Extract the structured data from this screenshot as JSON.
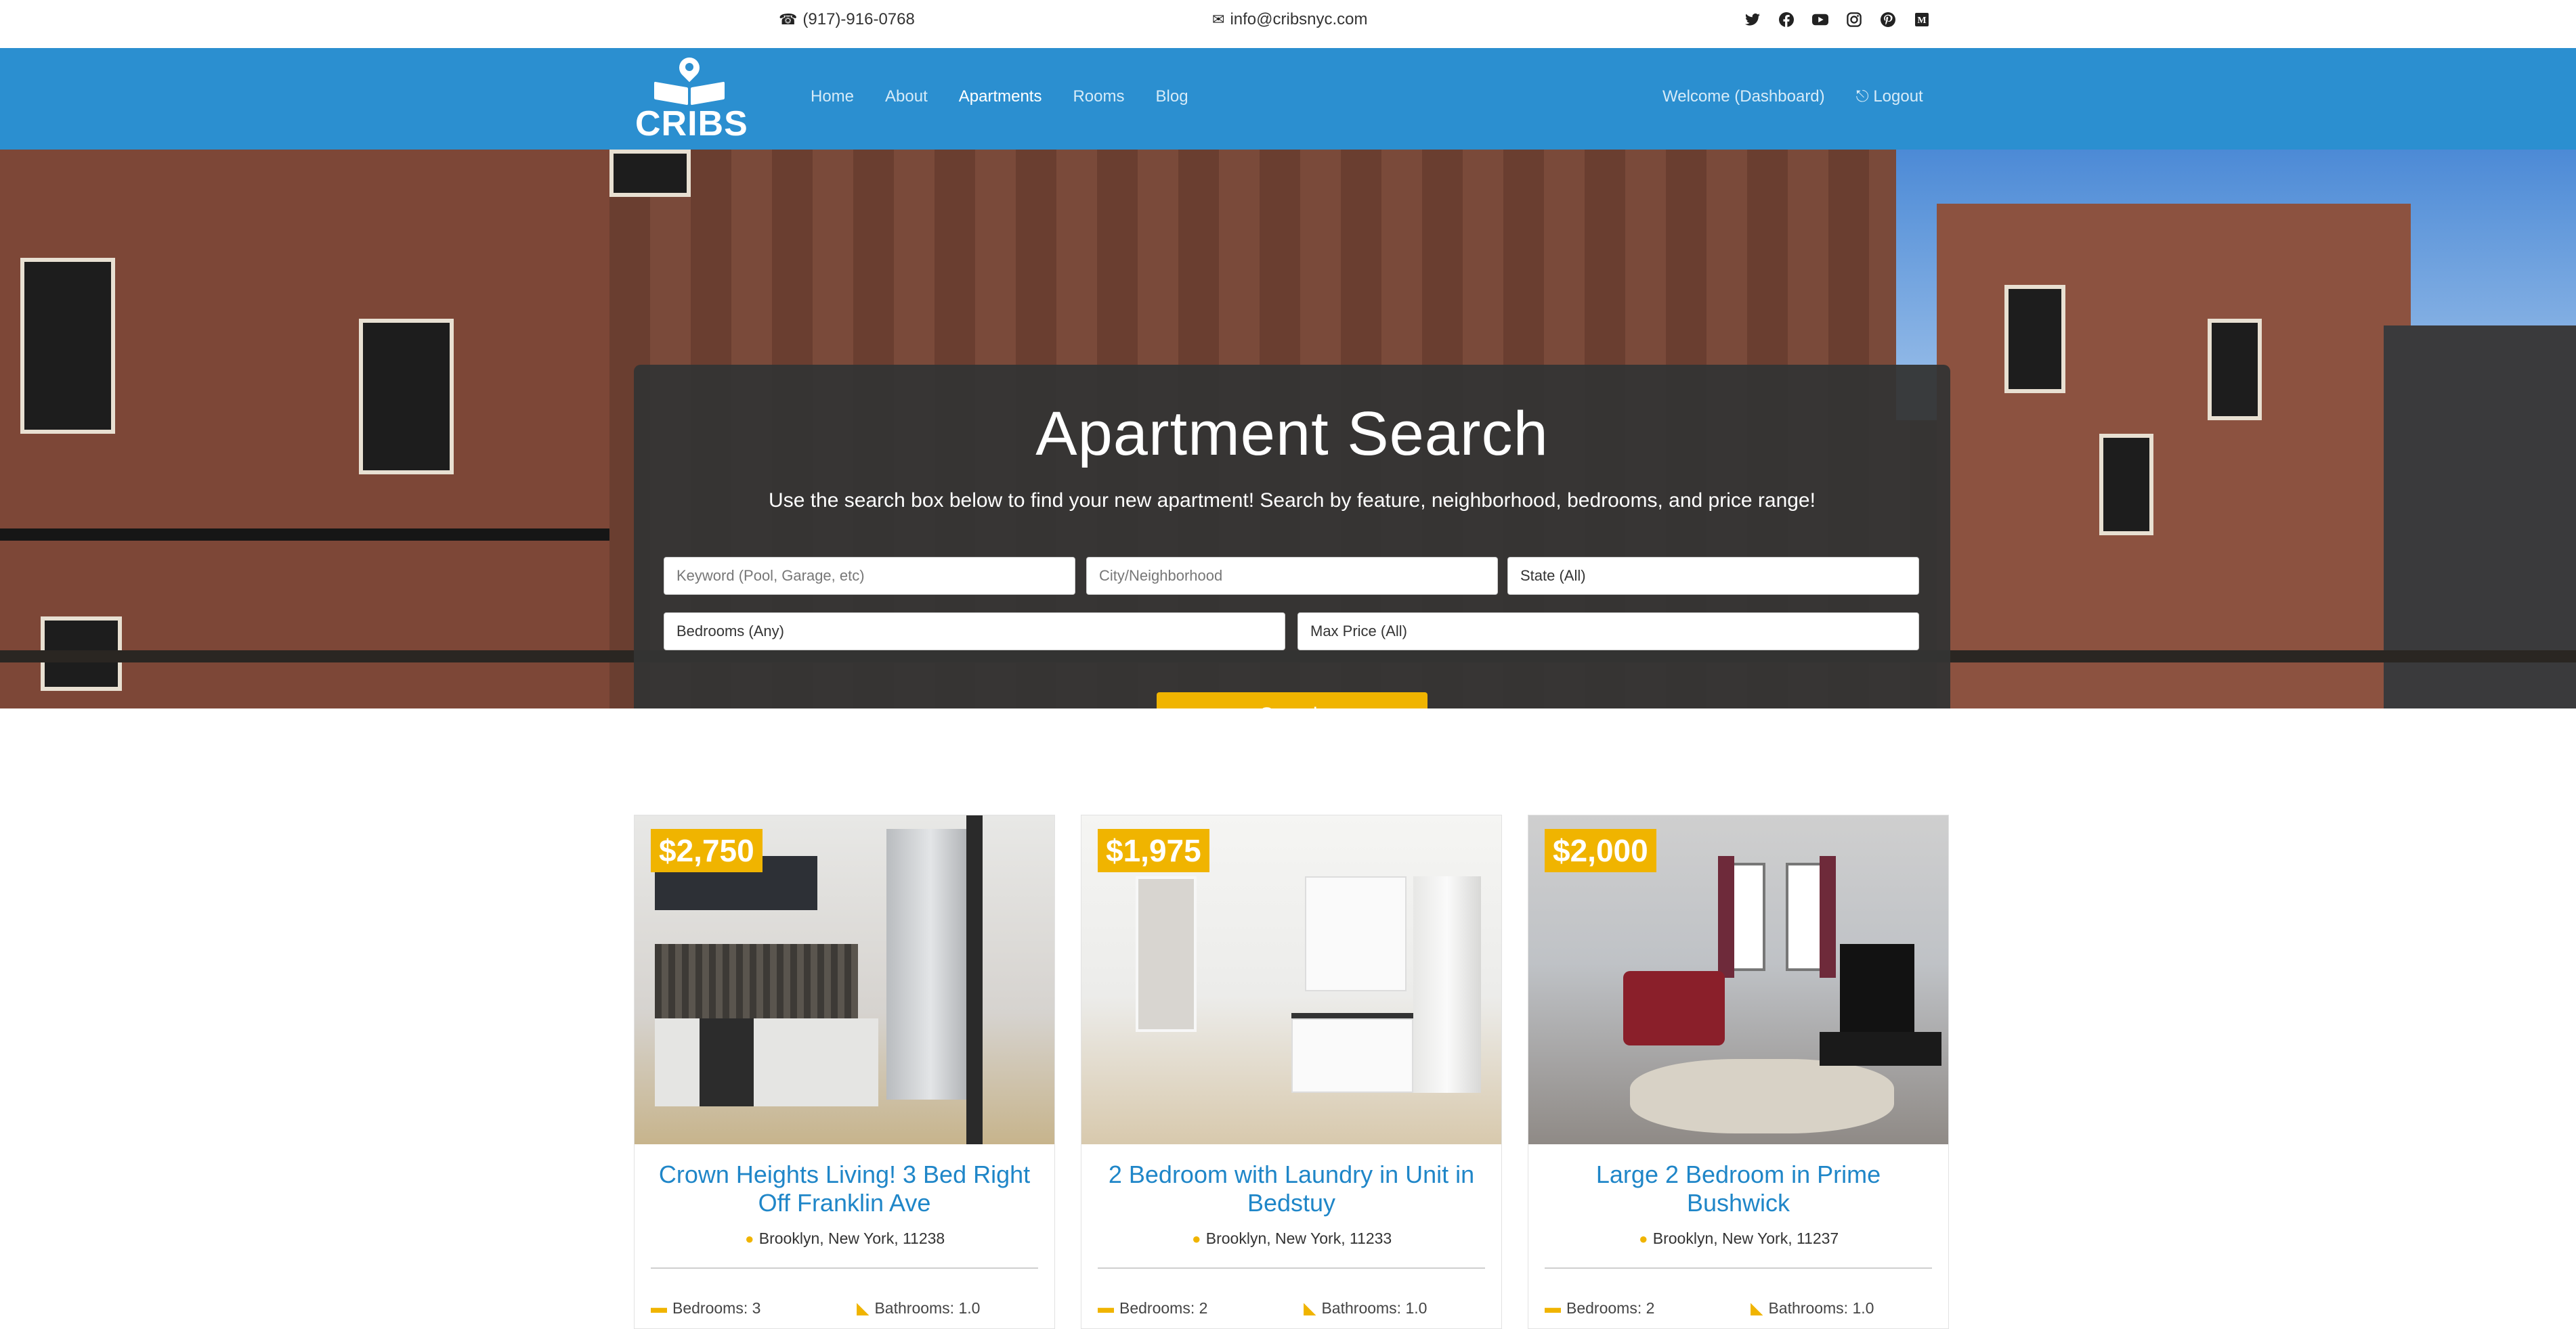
{
  "topbar": {
    "phone": "(917)-916-0768",
    "email": "info@cribsnyc.com",
    "socials": [
      "twitter-icon",
      "facebook-icon",
      "youtube-icon",
      "instagram-icon",
      "pinterest-icon",
      "medium-icon"
    ]
  },
  "nav": {
    "logo_text": "CRIBS",
    "links": [
      "Home",
      "About",
      "Apartments",
      "Rooms",
      "Blog"
    ],
    "active": "Apartments",
    "welcome": "Welcome (Dashboard)",
    "logout": "Logout"
  },
  "hero": {
    "title": "Apartment Search",
    "subtitle": "Use the search box below to find your new apartment! Search by feature, neighborhood, bedrooms, and price range!",
    "keyword_placeholder": "Keyword (Pool, Garage, etc)",
    "city_placeholder": "City/Neighborhood",
    "state_value": "State (All)",
    "bedrooms_value": "Bedrooms (Any)",
    "price_value": "Max Price (All)",
    "search_label": "Search"
  },
  "colors": {
    "primary": "#2b8fd0",
    "accent": "#f0b400",
    "panel": "#343434"
  },
  "listings": [
    {
      "price": "$2,750",
      "title": "Crown Heights Living! 3 Bed Right Off Franklin Ave",
      "location": "Brooklyn, New York, 11238",
      "bedrooms": "Bedrooms: 3",
      "bathrooms": "Bathrooms: 1.0"
    },
    {
      "price": "$1,975",
      "title": "2 Bedroom with Laundry in Unit in Bedstuy",
      "location": "Brooklyn, New York, 11233",
      "bedrooms": "Bedrooms: 2",
      "bathrooms": "Bathrooms: 1.0"
    },
    {
      "price": "$2,000",
      "title": "Large 2 Bedroom in Prime Bushwick",
      "location": "Brooklyn, New York, 11237",
      "bedrooms": "Bedrooms: 2",
      "bathrooms": "Bathrooms: 1.0"
    }
  ]
}
